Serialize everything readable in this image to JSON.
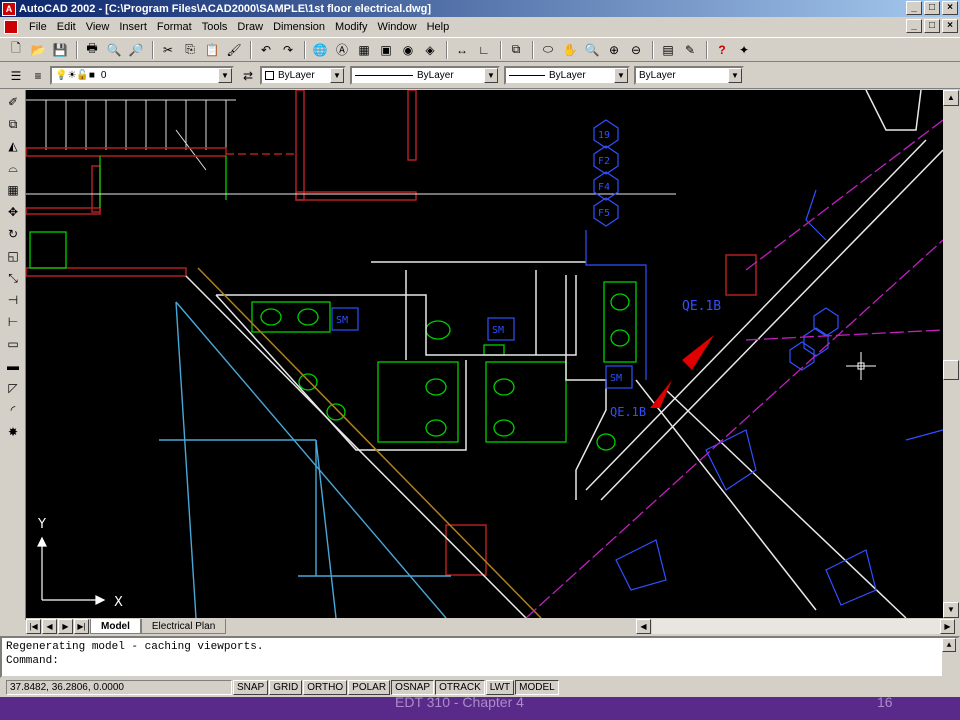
{
  "window": {
    "title": "AutoCAD 2002 - [C:\\Program Files\\ACAD2000\\SAMPLE\\1st floor electrical.dwg]",
    "buttons": [
      "_",
      "□",
      "×"
    ]
  },
  "menubar": {
    "items": [
      "File",
      "Edit",
      "View",
      "Insert",
      "Format",
      "Tools",
      "Draw",
      "Dimension",
      "Modify",
      "Window",
      "Help"
    ]
  },
  "toolbar_properties": {
    "layer": "0",
    "color": "ByLayer",
    "linetype": "ByLayer",
    "lineweight": "ByLayer",
    "plotstyle": "ByLayer"
  },
  "drawing": {
    "tags": [
      "19",
      "F2",
      "F4",
      "F5"
    ],
    "labels": [
      "SM",
      "SM",
      "SM",
      "QE.1B",
      "QE.1B"
    ],
    "ucs_y": "Y",
    "ucs_x": "X"
  },
  "layout_tabs": {
    "items": [
      "Model",
      "Electrical Plan"
    ],
    "active": "Model"
  },
  "command": {
    "history": "Regenerating model - caching viewports.",
    "prompt": "Command:"
  },
  "status": {
    "coordinates": "37.8482, 36.2806, 0.0000",
    "buttons": [
      "SNAP",
      "GRID",
      "ORTHO",
      "POLAR",
      "OSNAP",
      "OTRACK",
      "LWT",
      "MODEL"
    ]
  },
  "slide_footer": {
    "left": "EDT 310 - Chapter 4",
    "right": "16"
  },
  "colors": {
    "title_gradient_start": "#0a246a",
    "canvas_bg": "#000000",
    "cyan_lines": "#4aa8d8",
    "green_fixtures": "#00d000",
    "blue_lines": "#3050ff",
    "magenta_lines": "#c020c0",
    "red_walls": "#b02020"
  }
}
